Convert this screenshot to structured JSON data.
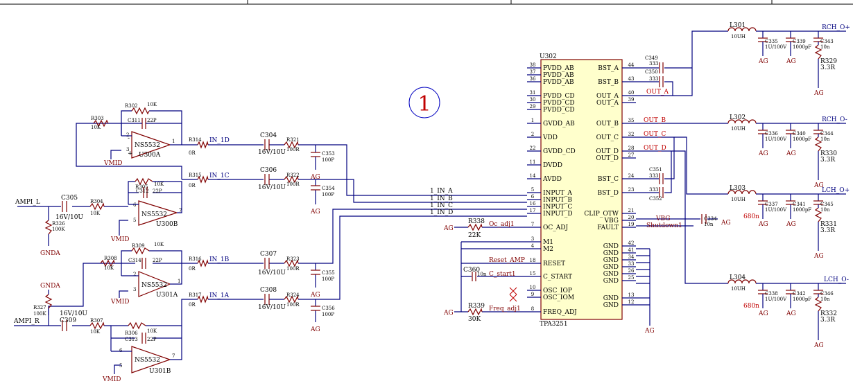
{
  "sheet_marker": "1",
  "chip": {
    "ref": "U302",
    "part": "TPA3251",
    "left_pins": [
      {
        "num": "38",
        "name": "PVDD_AB"
      },
      {
        "num": "37",
        "name": "PVDD_AB"
      },
      {
        "num": "36",
        "name": "PVDD_AB"
      },
      {
        "num": "31",
        "name": "PVDD_CD"
      },
      {
        "num": "30",
        "name": "PVDD_CD"
      },
      {
        "num": "29",
        "name": "PVDD_CD"
      },
      {
        "num": "1",
        "name": "GVDD_AB"
      },
      {
        "num": "2",
        "name": "VDD"
      },
      {
        "num": "22",
        "name": "GVDD_CD"
      },
      {
        "num": "11",
        "name": "DVDD"
      },
      {
        "num": "14",
        "name": "AVDD"
      },
      {
        "num": "5",
        "name": "INPUT_A"
      },
      {
        "num": "6",
        "name": "INPUT_B"
      },
      {
        "num": "16",
        "name": "INPUT_C"
      },
      {
        "num": "17",
        "name": "INPUT_D"
      },
      {
        "num": "7",
        "name": "OC_ADJ"
      },
      {
        "num": "3",
        "name": "M1"
      },
      {
        "num": "4",
        "name": "M2"
      },
      {
        "num": "18",
        "name": "RESET"
      },
      {
        "num": "15",
        "name": "C_START"
      },
      {
        "num": "10",
        "name": "OSC_IOP"
      },
      {
        "num": "9",
        "name": "OSC_IOM"
      },
      {
        "num": "8",
        "name": "FREQ_ADJ"
      }
    ],
    "right_pins": [
      {
        "num": "44",
        "name": "BST_A"
      },
      {
        "num": "43",
        "name": "BST_B"
      },
      {
        "num": "40",
        "name": "OUT_A"
      },
      {
        "num": "39",
        "name": "OUT_A"
      },
      {
        "num": "35",
        "name": "OUT_B"
      },
      {
        "num": "32",
        "name": "OUT_C"
      },
      {
        "num": "28",
        "name": "OUT_D"
      },
      {
        "num": "27",
        "name": "OUT_D"
      },
      {
        "num": "24",
        "name": "BST_C"
      },
      {
        "num": "23",
        "name": "BST_D"
      },
      {
        "num": "21",
        "name": "CLIP_OTW"
      },
      {
        "num": "20",
        "name": "VBG"
      },
      {
        "num": "19",
        "name": "FAULT"
      },
      {
        "num": "42",
        "name": "GND"
      },
      {
        "num": "41",
        "name": "GND"
      },
      {
        "num": "34",
        "name": "GND"
      },
      {
        "num": "33",
        "name": "GND"
      },
      {
        "num": "26",
        "name": "GND"
      },
      {
        "num": "25",
        "name": "GND"
      },
      {
        "num": "13",
        "name": "GND"
      },
      {
        "num": "12",
        "name": "GND"
      }
    ]
  },
  "nets": {
    "ampi_l": "AMPI_L",
    "ampi_r": "AMPI_R",
    "gnda": "GNDA",
    "gnda2": "GNDA",
    "vmid": "VMID",
    "in_1d": "IN_1D",
    "in_1c": "IN_1C",
    "in_1b": "IN_1B",
    "in_1a": "IN_1A",
    "bus_a": "1_IN_A",
    "bus_b": "1_IN_B",
    "bus_c": "1_IN_C",
    "bus_d": "1_IN_D",
    "out_a": "OUT_A",
    "out_b": "OUT_B",
    "out_c": "OUT_C",
    "out_d": "OUT_D",
    "rch_p": "RCH_O+",
    "rch_n": "RCH_O-",
    "lch_p": "LCH_O+",
    "lch_n": "LCH_O-",
    "oc_adj": "Oc_adj1",
    "reset": "Reset_AMP",
    "c_start": "C_start1",
    "freq": "Freq_adj1",
    "vbg": "VBG",
    "shutdown": "Shutdown1",
    "ag": "AG"
  },
  "opamps": [
    {
      "ref": "U300A",
      "part": "NS5532"
    },
    {
      "ref": "U300B",
      "part": "NS5532"
    },
    {
      "ref": "U301A",
      "part": "NS5532"
    },
    {
      "ref": "U301B",
      "part": "NS5532"
    }
  ],
  "resistors": {
    "r302": "R302",
    "r302v": "10K",
    "r303": "R303",
    "r303v": "10K",
    "r314": "R314",
    "r314v": "0R",
    "r321": "R321",
    "r321v": "100R",
    "r305": "R305",
    "r305v": "10K",
    "r315": "R315",
    "r315v": "0R",
    "r322": "R322",
    "r322v": "100R",
    "r304": "R304",
    "r304v": "10K",
    "r326": "R326",
    "r326v": "100K",
    "r309": "R309",
    "r309v": "10K",
    "r308": "R308",
    "r308v": "10K",
    "r316": "R316",
    "r316v": "0R",
    "r323": "R323",
    "r323v": "100R",
    "r317": "R317",
    "r317v": "0R",
    "r324": "R324",
    "r324v": "100R",
    "r327": "R327",
    "r327v": "100K",
    "r307": "R307",
    "r307v": "10K",
    "r306": "R306",
    "r306v": "10K",
    "r338": "R338",
    "r338v": "22K",
    "r339": "R339",
    "r339v": "30K",
    "r329": "R329",
    "r330": "R330",
    "r331": "R331",
    "r332": "R332",
    "rload": "3.3R"
  },
  "capacitors": {
    "c311": "C311",
    "c311v": "22P",
    "c312": "C312",
    "c312v": "22P",
    "c314": "C314",
    "c314v": "22P",
    "c313": "C313",
    "c313v": "22P",
    "c304": "C304",
    "c306": "C306",
    "c307": "C307",
    "c308": "C308",
    "c305": "C305",
    "c309": "C309",
    "ecap": "16V/10U",
    "c353": "C353",
    "c354": "C354",
    "c355": "C355",
    "c356": "C356",
    "c100p": "100P",
    "c360": "C360",
    "c360v": "10n",
    "c334": "C334",
    "c334v": "10n",
    "c349": "C349",
    "c350": "C350",
    "c351": "C351",
    "c352": "C352",
    "c333": "333",
    "c335": "C335",
    "c336": "C336",
    "c337": "C337",
    "c338": "C338",
    "c1u": "1U/100V",
    "c339": "C339",
    "c340": "C340",
    "c341": "C341",
    "c342": "C342",
    "c1000": "1000pF",
    "c343": "C343",
    "c344": "C344",
    "c345": "C345",
    "c346": "C346",
    "c10n": "10n",
    "c680": "680n"
  },
  "inductors": {
    "l301": "L301",
    "l302": "L302",
    "l303": "L303",
    "l304": "L304",
    "lval": "10UH"
  }
}
